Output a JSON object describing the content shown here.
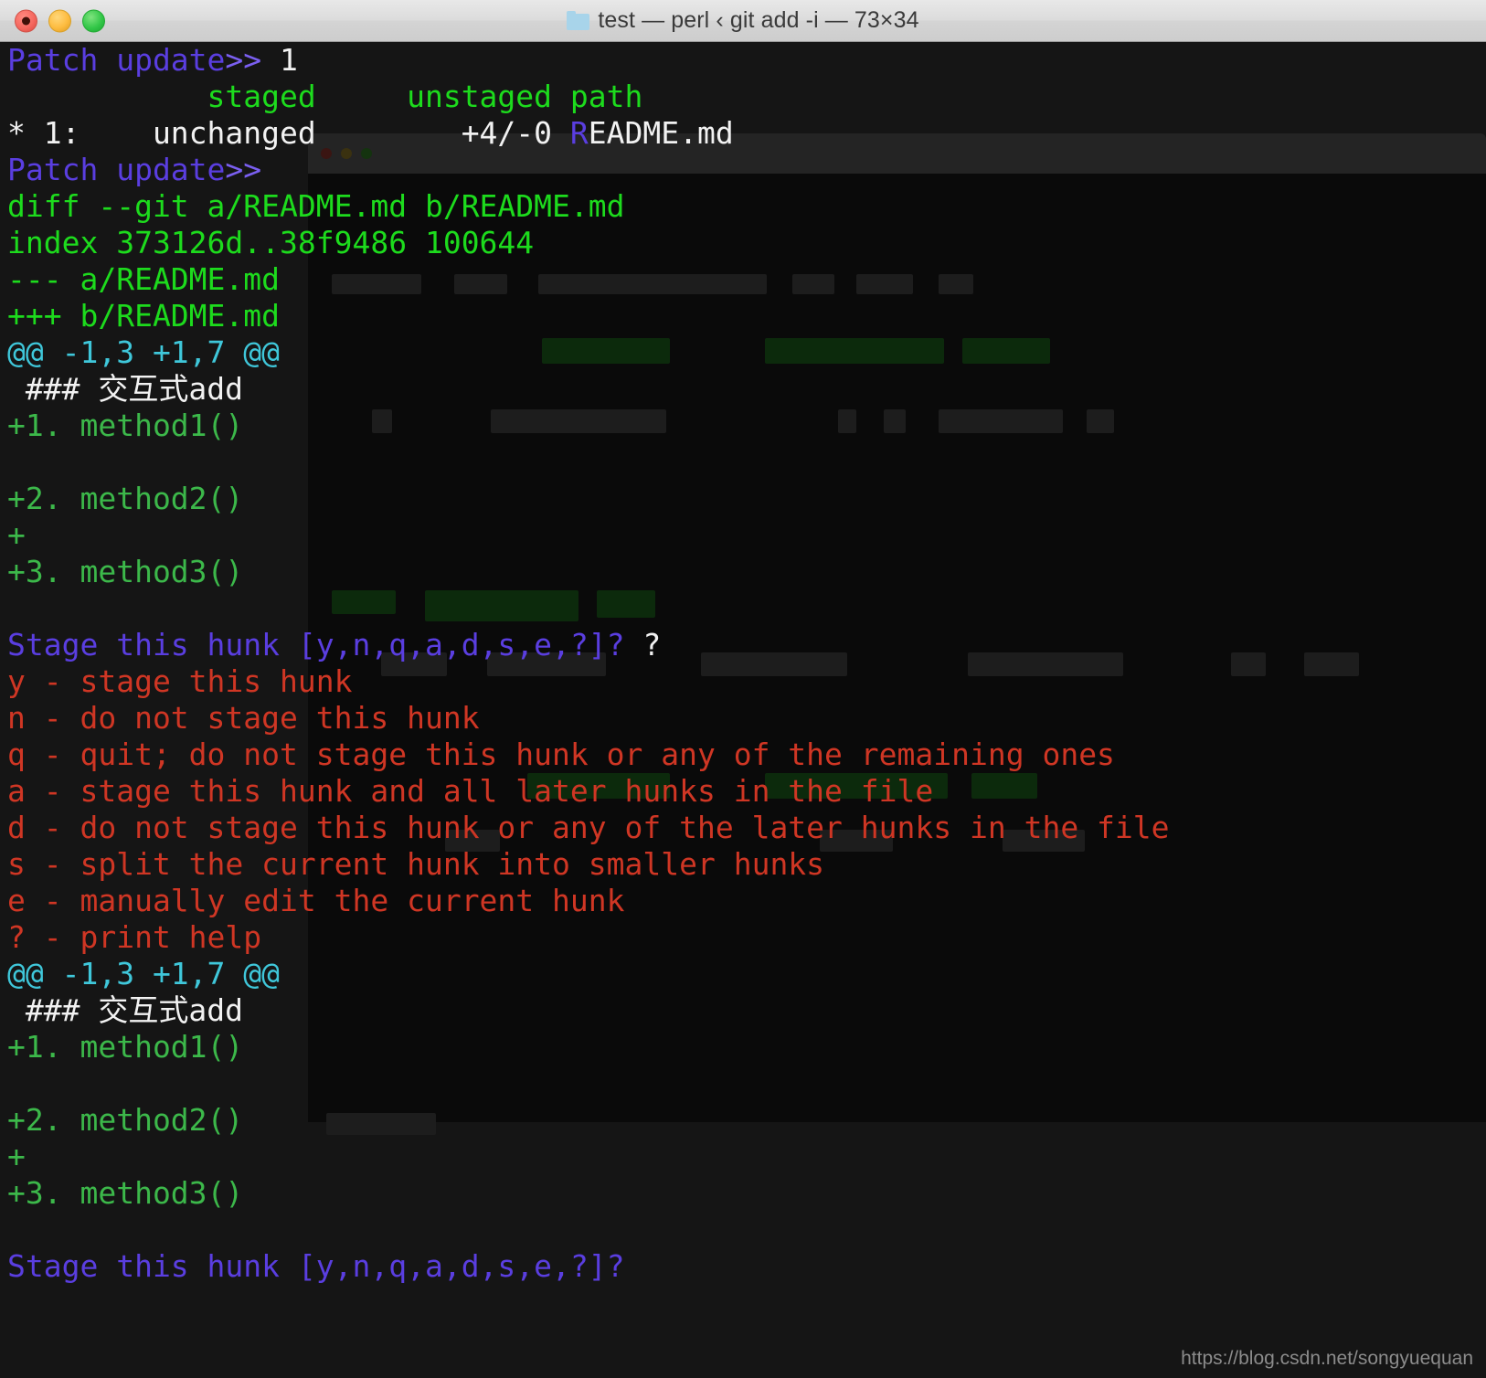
{
  "window": {
    "title": "test — perl ‹ git add -i — 73×34",
    "folder_icon": "folder-icon",
    "buttons": {
      "close": "close-button",
      "minimize": "minimize-button",
      "maximize": "maximize-button"
    },
    "columns": 73,
    "rows": 34
  },
  "terminal": {
    "lines": [
      {
        "id": "l0",
        "segments": [
          {
            "text": "Patch update",
            "color": "prompt"
          },
          {
            "text": ">>",
            "color": "promptsym"
          },
          {
            "text": " 1",
            "color": "white"
          }
        ]
      },
      {
        "id": "l1",
        "segments": [
          {
            "text": "           staged     unstaged path",
            "color": "green"
          }
        ]
      },
      {
        "id": "l2",
        "segments": [
          {
            "text": "* 1:    unchanged        +4/-0 ",
            "color": "white"
          },
          {
            "text": "R",
            "color": "purple"
          },
          {
            "text": "EADME.md",
            "color": "white"
          }
        ]
      },
      {
        "id": "l3",
        "segments": [
          {
            "text": "Patch update",
            "color": "prompt"
          },
          {
            "text": ">>",
            "color": "promptsym"
          }
        ]
      },
      {
        "id": "l4",
        "segments": [
          {
            "text": "diff --git a/README.md b/README.md",
            "color": "green"
          }
        ]
      },
      {
        "id": "l5",
        "segments": [
          {
            "text": "index 373126d..38f9486 100644",
            "color": "green"
          }
        ]
      },
      {
        "id": "l6",
        "segments": [
          {
            "text": "--- a/README.md",
            "color": "green"
          }
        ]
      },
      {
        "id": "l7",
        "segments": [
          {
            "text": "+++ b/README.md",
            "color": "green"
          }
        ]
      },
      {
        "id": "l8",
        "segments": [
          {
            "text": "@@ -1,3 +1,7 @@",
            "color": "cyan"
          }
        ]
      },
      {
        "id": "l9",
        "segments": [
          {
            "text": " ### 交互式add",
            "color": "white"
          }
        ]
      },
      {
        "id": "l10",
        "segments": [
          {
            "text": "+1. method1()",
            "color": "diffadd"
          }
        ]
      },
      {
        "id": "l11",
        "segments": [
          {
            "text": "",
            "color": "white"
          }
        ]
      },
      {
        "id": "l12",
        "segments": [
          {
            "text": "+2. method2()",
            "color": "diffadd"
          }
        ]
      },
      {
        "id": "l13",
        "segments": [
          {
            "text": "+",
            "color": "diffadd"
          }
        ]
      },
      {
        "id": "l14",
        "segments": [
          {
            "text": "+3. method3()",
            "color": "diffadd"
          }
        ]
      },
      {
        "id": "l15",
        "segments": [
          {
            "text": "",
            "color": "white"
          }
        ]
      },
      {
        "id": "l16",
        "segments": [
          {
            "text": "Stage this hunk [y,n,q,a,d,s,e,?]? ",
            "color": "purple"
          },
          {
            "text": "?",
            "color": "white"
          }
        ]
      },
      {
        "id": "l17",
        "segments": [
          {
            "text": "y - stage this hunk",
            "color": "red"
          }
        ]
      },
      {
        "id": "l18",
        "segments": [
          {
            "text": "n - do not stage this hunk",
            "color": "red"
          }
        ]
      },
      {
        "id": "l19",
        "segments": [
          {
            "text": "q - quit; do not stage this hunk or any of the remaining ones",
            "color": "red"
          }
        ]
      },
      {
        "id": "l20",
        "segments": [
          {
            "text": "a - stage this hunk and all later hunks in the file",
            "color": "red"
          }
        ]
      },
      {
        "id": "l21",
        "segments": [
          {
            "text": "d - do not stage this hunk or any of the later hunks in the file",
            "color": "red"
          }
        ]
      },
      {
        "id": "l22",
        "segments": [
          {
            "text": "s - split the current hunk into smaller hunks",
            "color": "red"
          }
        ]
      },
      {
        "id": "l23",
        "segments": [
          {
            "text": "e - manually edit the current hunk",
            "color": "red"
          }
        ]
      },
      {
        "id": "l24",
        "segments": [
          {
            "text": "? - print help",
            "color": "red"
          }
        ]
      },
      {
        "id": "l25",
        "segments": [
          {
            "text": "@@ -1,3 +1,7 @@",
            "color": "cyan"
          }
        ]
      },
      {
        "id": "l26",
        "segments": [
          {
            "text": " ### 交互式add",
            "color": "white"
          }
        ]
      },
      {
        "id": "l27",
        "segments": [
          {
            "text": "+1. method1()",
            "color": "diffadd"
          }
        ]
      },
      {
        "id": "l28",
        "segments": [
          {
            "text": "",
            "color": "white"
          }
        ]
      },
      {
        "id": "l29",
        "segments": [
          {
            "text": "+2. method2()",
            "color": "diffadd"
          }
        ]
      },
      {
        "id": "l30",
        "segments": [
          {
            "text": "+",
            "color": "diffadd"
          }
        ]
      },
      {
        "id": "l31",
        "segments": [
          {
            "text": "+3. method3()",
            "color": "diffadd"
          }
        ]
      },
      {
        "id": "l32",
        "segments": [
          {
            "text": "",
            "color": "white"
          }
        ]
      },
      {
        "id": "l33",
        "segments": [
          {
            "text": "Stage this hunk [y,n,q,a,d,s,e,?]?",
            "color": "purple"
          }
        ]
      }
    ]
  },
  "watermark": {
    "text": "https://blog.csdn.net/songyuequan"
  },
  "colors": {
    "background": "#151515",
    "prompt": "#5a3ee0",
    "prompt_symbol": "#7a5ff0",
    "plain": "#f2f2f2",
    "diff_header_green": "#1ddb1d",
    "diff_added_green": "#3cb84a",
    "hunk_cyan": "#3fc7da",
    "help_red": "#cf3624",
    "titlebar_text": "#3a3a3a",
    "close_button": "#f5685f",
    "minimize_button": "#fdbc40",
    "maximize_button": "#34c749",
    "folder_icon": "#a8d4ea",
    "watermark": "#8b8b8b"
  }
}
